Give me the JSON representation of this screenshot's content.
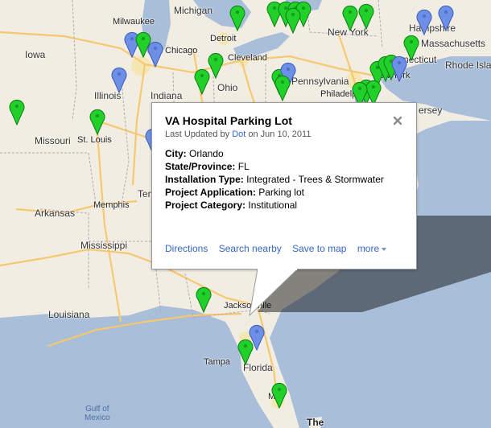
{
  "map": {
    "colors": {
      "land": "#f1ede2",
      "water": "#a9bfd9",
      "highway": "#f7c86f",
      "urban": "#f6e6b2",
      "marker_green": "#21d12a",
      "marker_blue": "#6d8fe6"
    },
    "labels": {
      "michigan": "Michigan",
      "milwaukee": "Milwaukee",
      "detroit": "Detroit",
      "iowa": "Iowa",
      "chicago": "Chicago",
      "cleveland": "Cleveland",
      "illinois": "Illinois",
      "indiana": "Indiana",
      "ohio": "Ohio",
      "missouri": "Missouri",
      "stlouis": "St. Louis",
      "pennsylvania": "Pennsylvania",
      "philadelphia": "Philadelphia",
      "newyork": "New York",
      "newhampshire": "Hampshire",
      "massachusetts": "Massachusetts",
      "connecticut": "Connecticut",
      "rhodeisland": "Rhode Isla",
      "newyork2": "New York",
      "jersey": "ersey",
      "arkansas": "Arkansas",
      "memphis": "Memphis",
      "mississippi": "Mississippi",
      "louisiana": "Louisiana",
      "jacksonville": "Jacksonville",
      "tampa": "Tampa",
      "florida": "Florida",
      "miami": "Mia",
      "gulf": "Gulf of\nMexico",
      "the": "The",
      "ten": "Ten"
    }
  },
  "popup": {
    "title": "VA Hospital Parking Lot",
    "updated_prefix": "Last Updated by",
    "updated_user": "Dot",
    "updated_suffix": "on Jun 10, 2011",
    "fields": [
      {
        "label": "City:",
        "value": "Orlando"
      },
      {
        "label": "State/Province:",
        "value": "FL"
      },
      {
        "label": "Installation Type:",
        "value": "Integrated - Trees & Stormwater"
      },
      {
        "label": "Project Application:",
        "value": "Parking lot"
      },
      {
        "label": "Project Category:",
        "value": "Institutional"
      }
    ],
    "actions": {
      "directions": "Directions",
      "nearby": "Search nearby",
      "save": "Save to map",
      "more": "more"
    }
  }
}
